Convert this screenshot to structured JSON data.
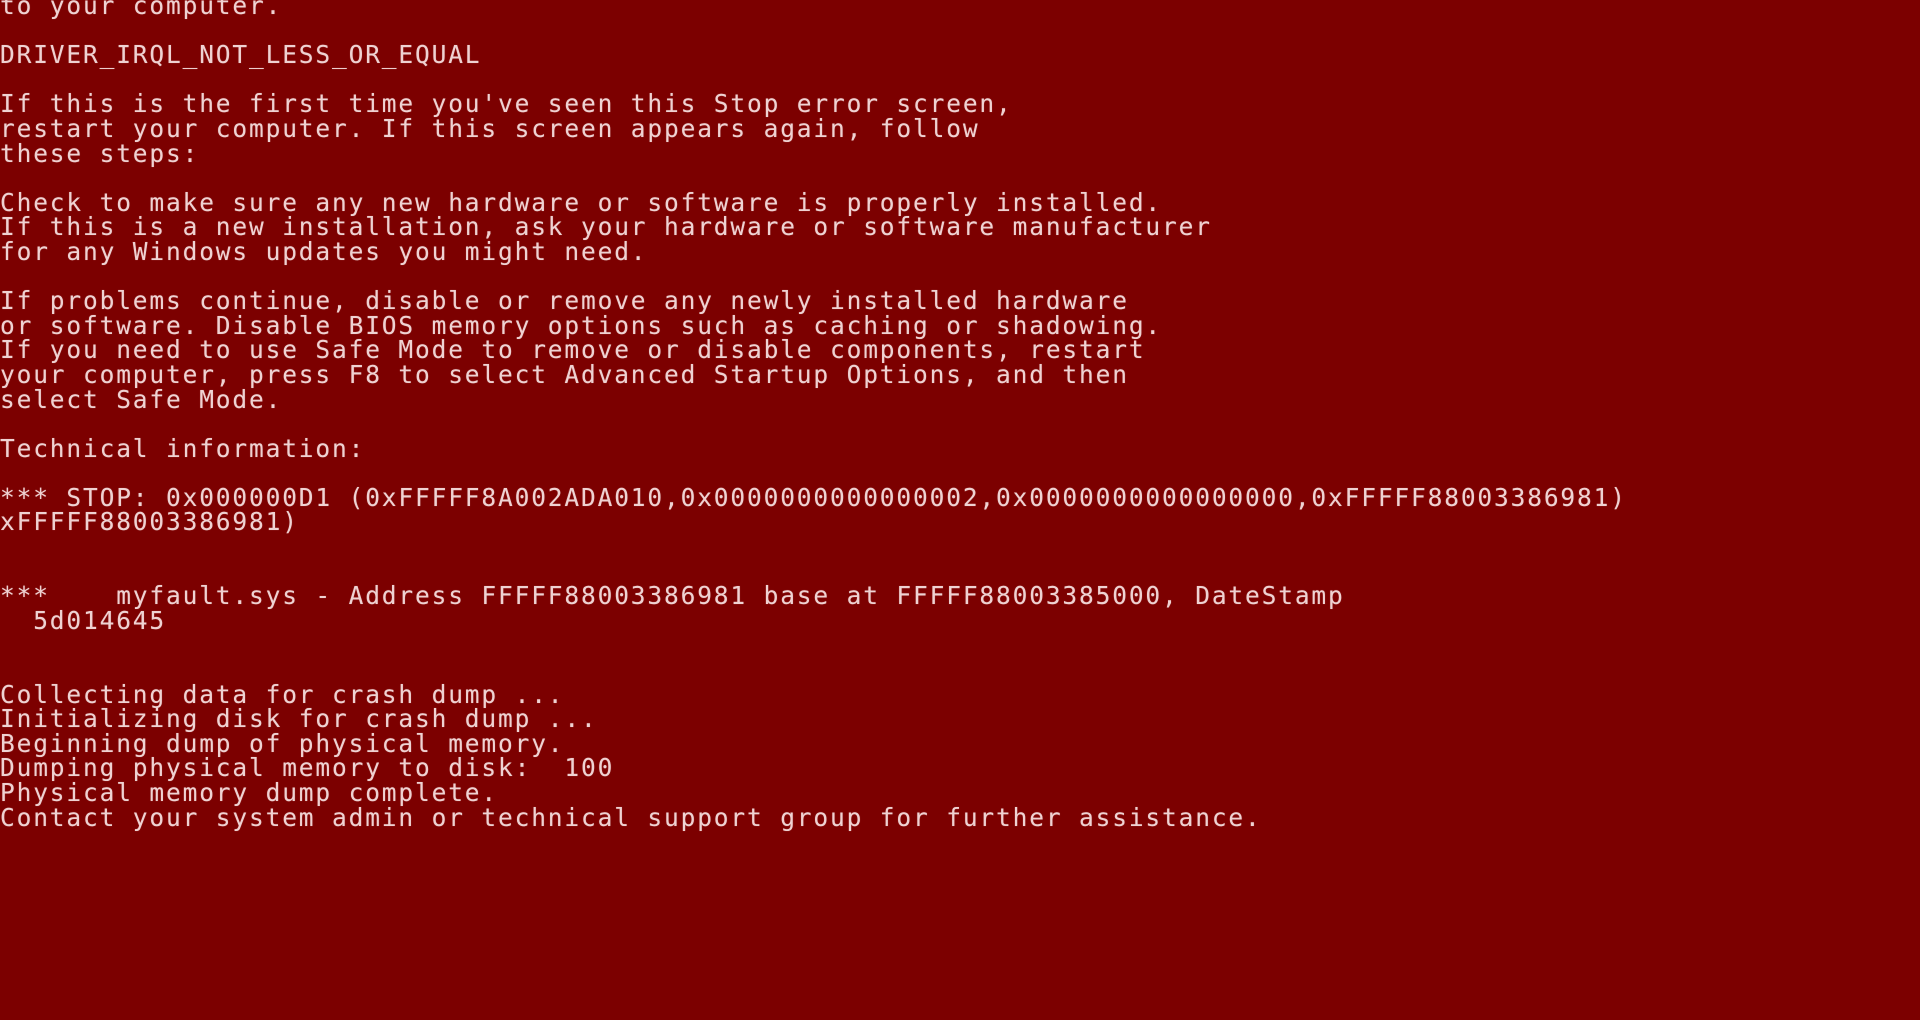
{
  "screen": {
    "name": "windows-stop-error-screen",
    "background_color": "#7c0000",
    "text_color": "#efd2d2",
    "bugcheck_name": "DRIVER_IRQL_NOT_LESS_OR_EQUAL"
  },
  "lines": [
    "to your computer.",
    "",
    "DRIVER_IRQL_NOT_LESS_OR_EQUAL",
    "",
    "If this is the first time you've seen this Stop error screen,",
    "restart your computer. If this screen appears again, follow",
    "these steps:",
    "",
    "Check to make sure any new hardware or software is properly installed.",
    "If this is a new installation, ask your hardware or software manufacturer",
    "for any Windows updates you might need.",
    "",
    "If problems continue, disable or remove any newly installed hardware",
    "or software. Disable BIOS memory options such as caching or shadowing.",
    "If you need to use Safe Mode to remove or disable components, restart",
    "your computer, press F8 to select Advanced Startup Options, and then",
    "select Safe Mode.",
    "",
    "Technical information:",
    "",
    "*** STOP: 0x000000D1 (0xFFFFF8A002ADA010,0x0000000000000002,0x0000000000000000,0xFFFFF88003386981)",
    "xFFFFF88003386981)",
    "",
    "",
    "***    myfault.sys - Address FFFFF88003386981 base at FFFFF88003385000, DateStamp",
    "  5d014645",
    "",
    "",
    "Collecting data for crash dump ...",
    "Initializing disk for crash dump ...",
    "Beginning dump of physical memory.",
    "Dumping physical memory to disk:  100",
    "Physical memory dump complete.",
    "Contact your system admin or technical support group for further assistance."
  ],
  "technical_information": {
    "label": "Technical information:",
    "stop_code": "0x000000D1",
    "parameters": [
      "0xFFFFF8A002ADA010",
      "0x0000000000000002",
      "0x0000000000000000",
      "0xFFFFF88003386981"
    ],
    "driver": "myfault.sys",
    "address": "FFFFF88003386981",
    "base": "FFFFF88003385000",
    "datestamp": "5d014645"
  },
  "dump_status": {
    "collecting": "Collecting data for crash dump ...",
    "initializing": "Initializing disk for crash dump ...",
    "beginning": "Beginning dump of physical memory.",
    "progress_label": "Dumping physical memory to disk:",
    "progress_value": "100",
    "complete": "Physical memory dump complete.",
    "contact": "Contact your system admin or technical support group for further assistance."
  }
}
